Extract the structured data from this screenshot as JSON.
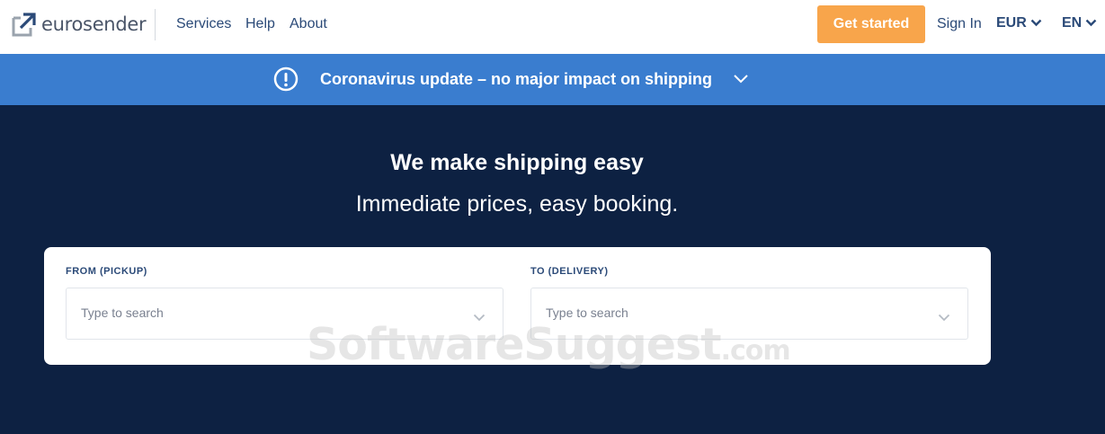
{
  "header": {
    "logo_text": "eurosender",
    "nav": [
      {
        "label": "Services"
      },
      {
        "label": "Help"
      },
      {
        "label": "About"
      }
    ],
    "get_started_label": "Get started",
    "sign_in_label": "Sign In",
    "currency": "EUR",
    "language": "EN",
    "accent_color": "#f8a54b"
  },
  "banner": {
    "icon": "exclamation-circle-icon",
    "text": "Coronavirus update – no major impact on shipping",
    "color": "#3a7dcf"
  },
  "hero": {
    "title": "We make shipping easy",
    "subtitle": "Immediate prices, easy booking.",
    "background_color": "#0d2142"
  },
  "search": {
    "from_label": "FROM (PICKUP)",
    "from_placeholder": "Type to search",
    "to_label": "TO (DELIVERY)",
    "to_placeholder": "Type to search"
  },
  "watermark": {
    "main": "SoftwareSuggest",
    "suffix": ".com"
  }
}
